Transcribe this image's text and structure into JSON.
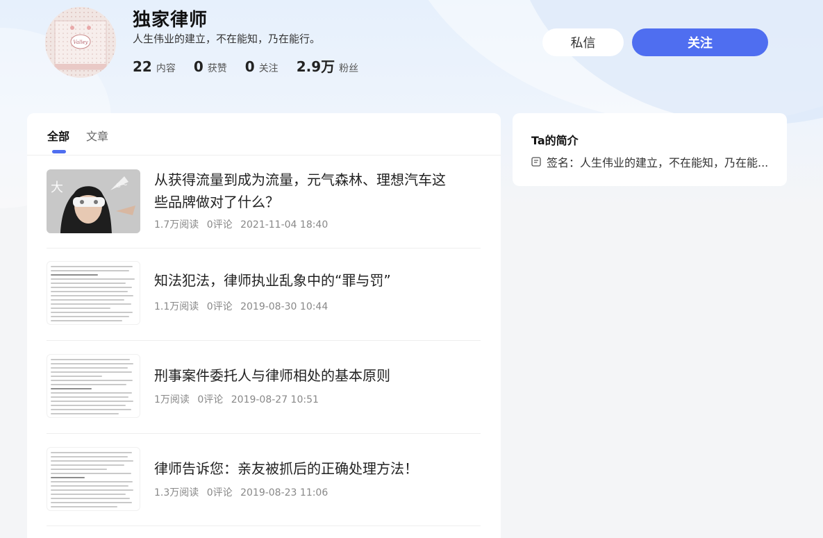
{
  "profile": {
    "name": "独家律师",
    "signature": "人生伟业的建立，不在能知，乃在能行。",
    "avatar_text": "Valley",
    "stats": [
      {
        "value": "22",
        "label": "内容"
      },
      {
        "value": "0",
        "label": "获赞"
      },
      {
        "value": "0",
        "label": "关注"
      },
      {
        "value": "2.9万",
        "label": "粉丝"
      }
    ]
  },
  "actions": {
    "message_label": "私信",
    "follow_label": "关注"
  },
  "tabs": [
    {
      "label": "全部",
      "active": true
    },
    {
      "label": "文章",
      "active": false
    }
  ],
  "articles": [
    {
      "title": "从获得流量到成为流量，元气森林、理想汽车这些品牌做对了什么？",
      "reads": "1.7万阅读",
      "comments": "0评论",
      "time": "2021-11-04 18:40",
      "thumb_icon": "photo-thumbnail-icon"
    },
    {
      "title": "知法犯法，律师执业乱象中的“罪与罚”",
      "reads": "1.1万阅读",
      "comments": "0评论",
      "time": "2019-08-30 10:44",
      "thumb_icon": "document-thumbnail-icon"
    },
    {
      "title": "刑事案件委托人与律师相处的基本原则",
      "reads": "1万阅读",
      "comments": "0评论",
      "time": "2019-08-27 10:51",
      "thumb_icon": "document-thumbnail-icon"
    },
    {
      "title": "律师告诉您：亲友被抓后的正确处理方法！",
      "reads": "1.3万阅读",
      "comments": "0评论",
      "time": "2019-08-23 11:06",
      "thumb_icon": "document-thumbnail-icon"
    }
  ],
  "intro": {
    "title": "Ta的简介",
    "signature": "签名：人生伟业的建立，不在能知，乃在能..."
  },
  "colors": {
    "accent": "#4f6ef0",
    "background": "#f4f5f7",
    "header_bg": "#e6f0fc"
  }
}
